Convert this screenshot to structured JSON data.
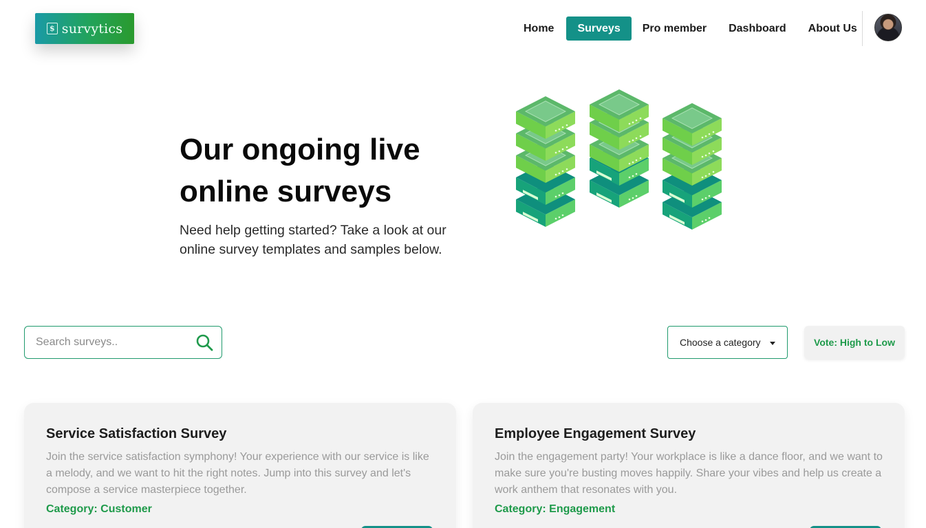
{
  "brand": {
    "name": "survytics",
    "icon_glyph": "$",
    "gradient": [
      "#1a9aa6",
      "#2a9a2e"
    ]
  },
  "nav": {
    "items": [
      {
        "label": "Home",
        "active": false
      },
      {
        "label": "Surveys",
        "active": true
      },
      {
        "label": "Pro member",
        "active": false
      },
      {
        "label": "Dashboard",
        "active": false
      },
      {
        "label": "About Us",
        "active": false
      }
    ],
    "active_color": "#149188"
  },
  "hero": {
    "title_line1": "Our ongoing live",
    "title_line2": "online surveys",
    "subtitle": "Need help getting started? Take a look at our online survey templates and samples below.",
    "illustration": "server-stacks-illustration"
  },
  "controls": {
    "search_placeholder": "Search surveys..",
    "search_icon": "search-icon",
    "category_label": "Choose a category",
    "vote_label": "Vote: High to Low"
  },
  "cards": [
    {
      "title": "Service Satisfaction Survey",
      "description": "Join the service satisfaction symphony! Your experience with our service is like a melody, and we want to hit the right notes. Jump into this survey and let's compose a service masterpiece together.",
      "category_prefix": "Category:",
      "category": "Customer"
    },
    {
      "title": "Employee Engagement Survey",
      "description": "Join the engagement party! Your workplace is like a dance floor, and we want to make sure you're busting moves happily. Share your vibes and help us create a work anthem that resonates with you.",
      "category_prefix": "Category:",
      "category": "Engagement"
    }
  ],
  "colors": {
    "accent_green": "#1e9a4a",
    "accent_teal": "#149188",
    "card_bg": "#f2f2f2"
  }
}
